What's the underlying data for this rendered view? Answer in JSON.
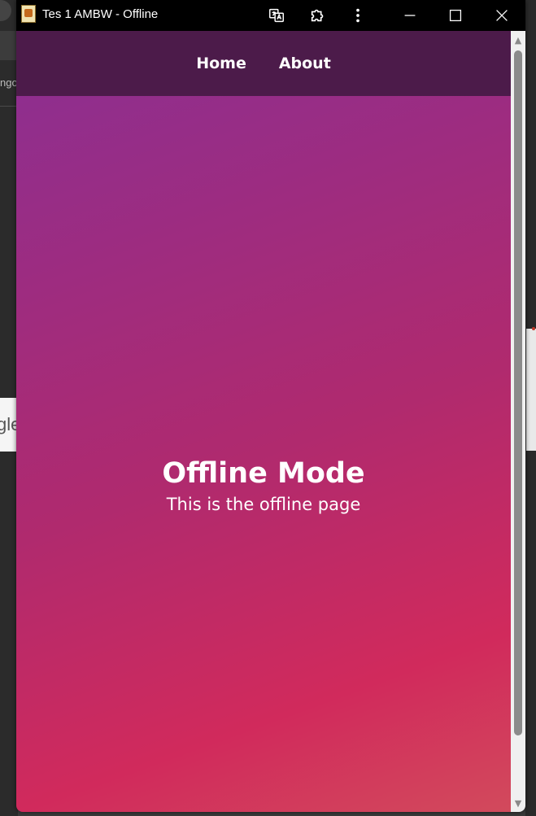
{
  "window": {
    "title": "Tes 1 AMBW - Offline",
    "icons": [
      "translate-icon",
      "extension-icon",
      "more-options-icon",
      "minimize-icon",
      "maximize-icon",
      "close-icon"
    ]
  },
  "background_window": {
    "address_fragment": "ngo",
    "search_fragment": "gle"
  },
  "nav": {
    "home_label": "Home",
    "about_label": "About"
  },
  "hero": {
    "title": "Offline Mode",
    "subtitle": "This is the offline page"
  },
  "colors": {
    "navbar": "#4c1b4a",
    "gradient_start": "#8f2e8e",
    "gradient_end": "#d24a5c",
    "titlebar": "#000000"
  }
}
